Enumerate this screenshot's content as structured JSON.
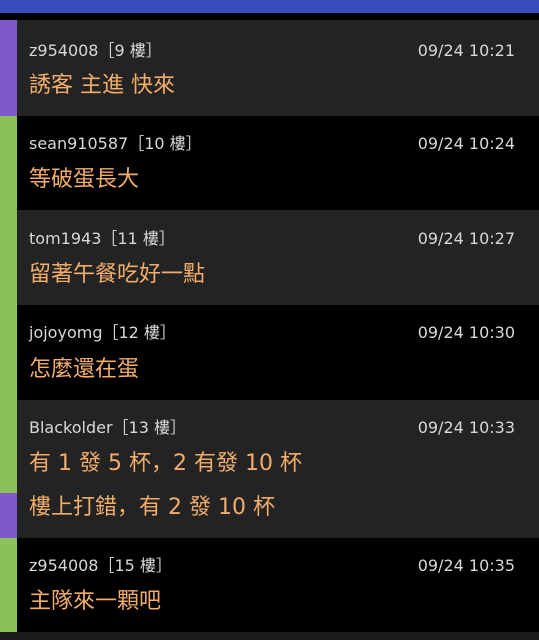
{
  "colors": {
    "top_strip": "#3a4bbd",
    "bar_purple": "#7e59c9",
    "bar_green": "#8cc05b",
    "row_light": "#232323",
    "row_dark": "#000000",
    "meta_text": "#d8d8d8",
    "comment_text": "#f2ad6a"
  },
  "comments": [
    {
      "author": "z954008",
      "floor": "［9 樓］",
      "time": "09/24 10:21",
      "lines": [
        "誘客 主進 快來"
      ]
    },
    {
      "author": "sean910587",
      "floor": "［10 樓］",
      "time": "09/24 10:24",
      "lines": [
        "等破蛋長大"
      ]
    },
    {
      "author": "tom1943",
      "floor": "［11 樓］",
      "time": "09/24 10:27",
      "lines": [
        "留著午餐吃好一點"
      ]
    },
    {
      "author": "jojoyomg",
      "floor": "［12 樓］",
      "time": "09/24 10:30",
      "lines": [
        "怎麼還在蛋"
      ]
    },
    {
      "author": "Blackolder",
      "floor": "［13 樓］",
      "time": "09/24 10:33",
      "lines": [
        "有 1 發 5 杯，2 有發 10 杯",
        "樓上打錯，有 2 發 10 杯"
      ]
    },
    {
      "author": "z954008",
      "floor": "［15 樓］",
      "time": "09/24 10:35",
      "lines": [
        "主隊來一顆吧"
      ]
    }
  ]
}
